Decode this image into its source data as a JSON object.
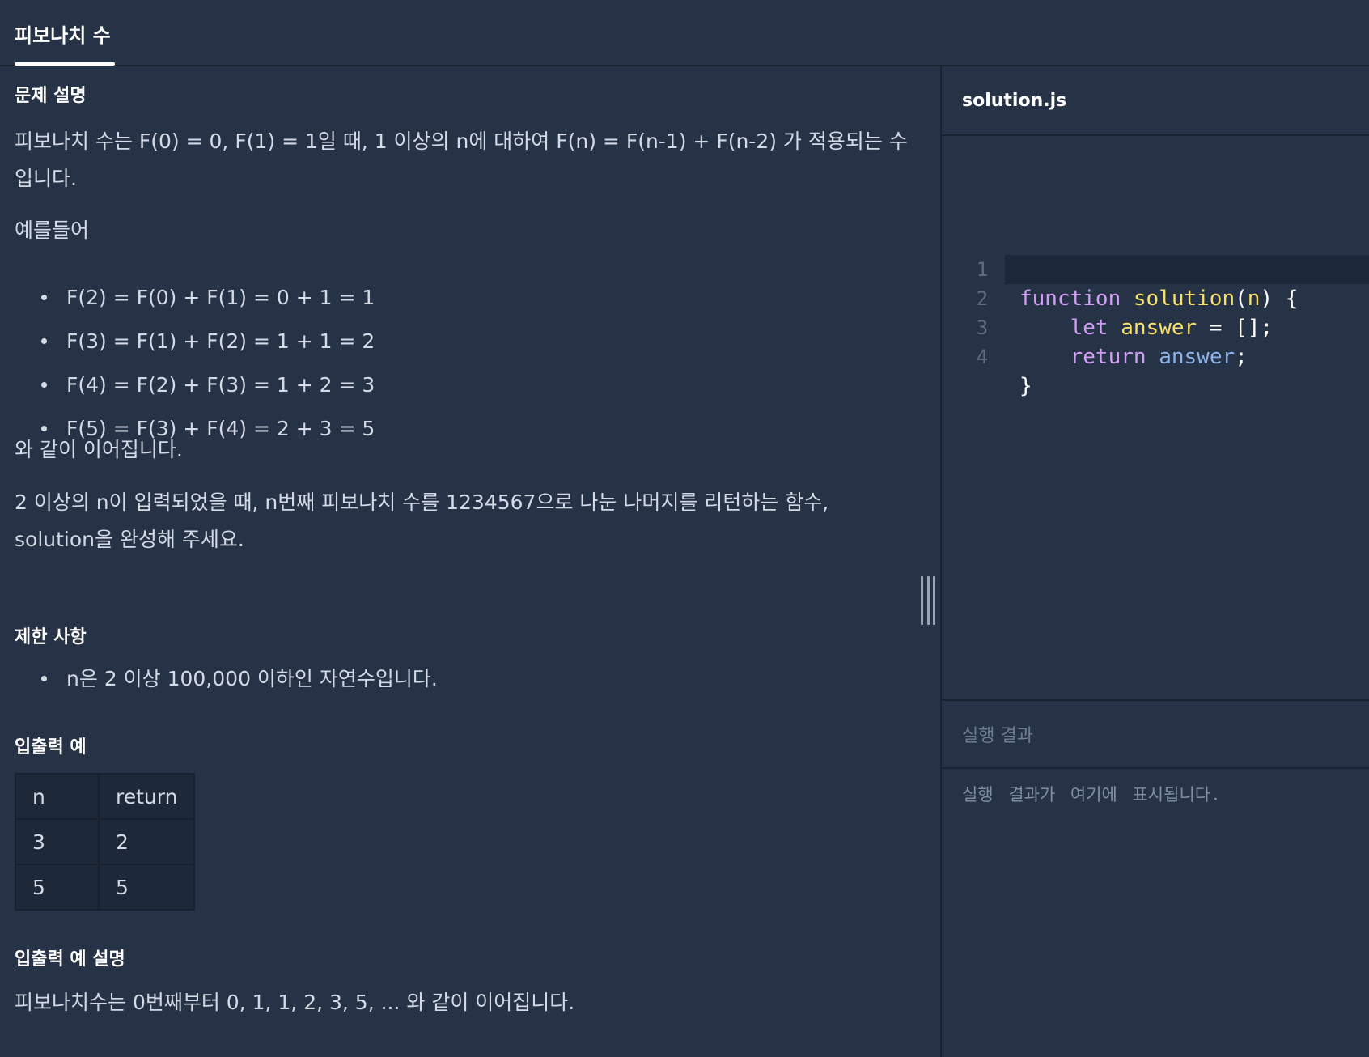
{
  "tab": {
    "title": "피보나치 수"
  },
  "problem": {
    "heading_description": "문제 설명",
    "para1_line1": "피보나치 수는 F(0) = 0, F(1) = 1일 때, 1 이상의 n에 대하여 F(n) = F(n-1) + F(n-2) 가 적용되는 수",
    "para1_line2": "입니다.",
    "example_intro": "예를들어",
    "examples": [
      "F(2) = F(0) + F(1) = 0 + 1 = 1",
      "F(3) = F(1) + F(2) = 1 + 1 = 2",
      "F(4) = F(2) + F(3) = 1 + 2 = 3",
      "F(5) = F(3) + F(4) = 2 + 3 = 5"
    ],
    "continue_text": "와 같이 이어집니다.",
    "task_line1": "2 이상의 n이 입력되었을 때, n번째 피보나치 수를 1234567으로 나눈 나머지를 리턴하는 함수,",
    "task_line2": "solution을 완성해 주세요.",
    "heading_constraints": "제한 사항",
    "constraints": [
      "n은 2 이상 100,000 이하인 자연수입니다."
    ],
    "heading_io": "입출력 예",
    "io_table": {
      "headers": [
        "n",
        "return"
      ],
      "rows": [
        [
          "3",
          "2"
        ],
        [
          "5",
          "5"
        ]
      ]
    },
    "heading_io_explain": "입출력 예 설명",
    "io_explain": "피보나치수는 0번째부터 0, 1, 1, 2, 3, 5, ... 와 같이 이어집니다."
  },
  "editor": {
    "filename": "solution.js",
    "line_numbers": [
      "1",
      "2",
      "3",
      "4"
    ],
    "code": {
      "l1_kw": "function",
      "l1_fn": "solution",
      "l1_open": "(",
      "l1_param": "n",
      "l1_close": ") {",
      "l2_kw": "let",
      "l2_var": "answer",
      "l2_rest": " = [];",
      "l3_kw": "return",
      "l3_ref": "answer",
      "l3_rest": ";",
      "l4": "}"
    }
  },
  "result": {
    "heading": "실행 결과",
    "placeholder": "실행 결과가 여기에 표시됩니다."
  }
}
